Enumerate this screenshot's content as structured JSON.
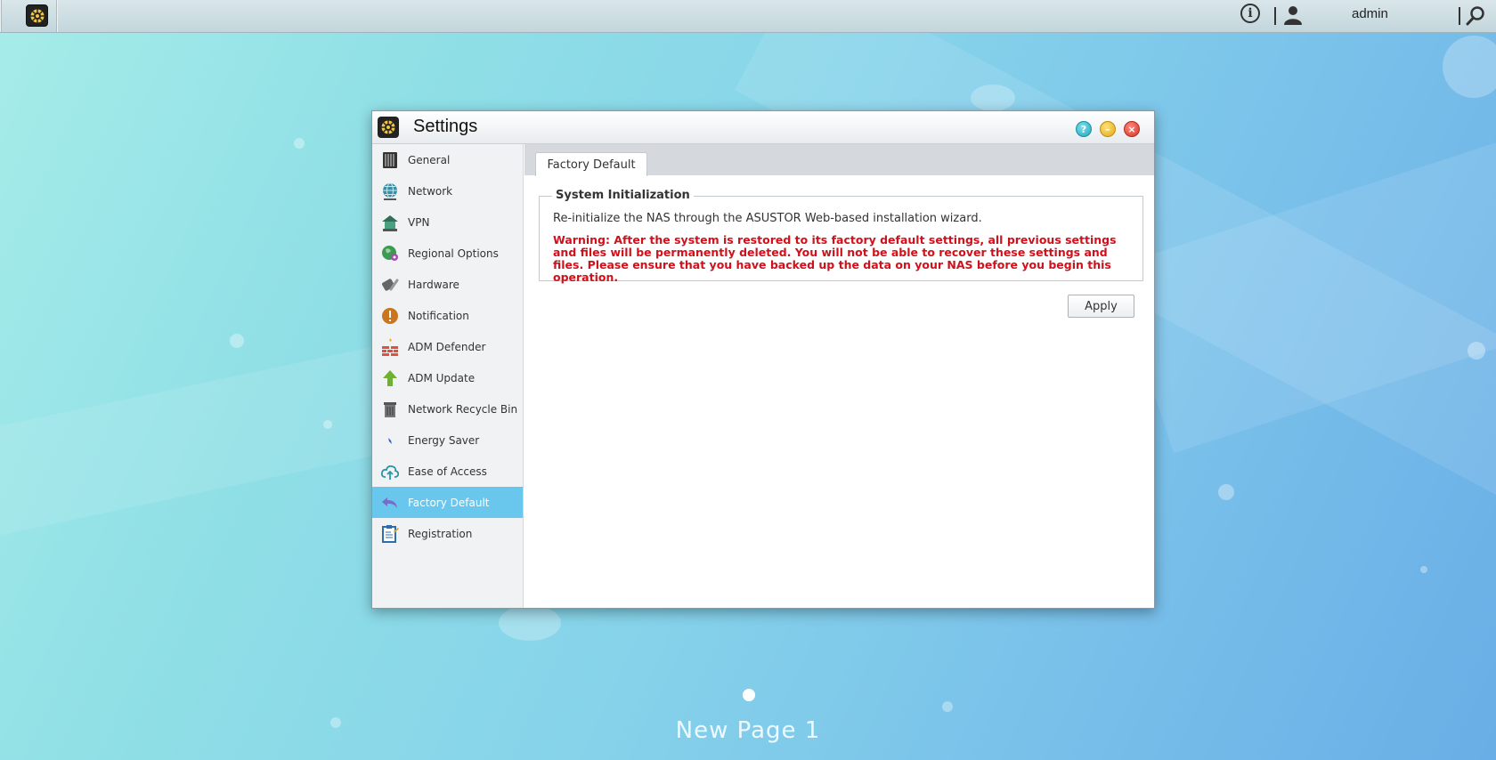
{
  "topbar": {
    "user_label": "admin"
  },
  "window": {
    "title": "Settings"
  },
  "sidebar": {
    "items": [
      {
        "label": "General",
        "icon": "server-icon"
      },
      {
        "label": "Network",
        "icon": "globe-network-icon"
      },
      {
        "label": "VPN",
        "icon": "vpn-house-icon"
      },
      {
        "label": "Regional Options",
        "icon": "globe-pin-icon"
      },
      {
        "label": "Hardware",
        "icon": "hardware-wrench-icon"
      },
      {
        "label": "Notification",
        "icon": "exclamation-icon"
      },
      {
        "label": "ADM Defender",
        "icon": "firewall-icon"
      },
      {
        "label": "ADM Update",
        "icon": "up-arrow-icon"
      },
      {
        "label": "Network Recycle Bin",
        "icon": "trash-bin-icon"
      },
      {
        "label": "Energy Saver",
        "icon": "lightning-icon"
      },
      {
        "label": "Ease of Access",
        "icon": "cloud-upload-icon"
      },
      {
        "label": "Factory Default",
        "icon": "undo-arrow-icon",
        "active": true
      },
      {
        "label": "Registration",
        "icon": "clipboard-icon"
      }
    ]
  },
  "content": {
    "tab_label": "Factory Default",
    "section_title": "System Initialization",
    "description": "Re-initialize the NAS through the ASUSTOR Web-based installation wizard.",
    "warning": "Warning: After the system is restored to its factory default settings, all previous settings and files will be permanently deleted. You will not be able to recover these settings and files. Please ensure that you have backed up the data on your NAS before you begin this operation.",
    "apply_label": "Apply"
  },
  "desktop": {
    "page_label": "New Page 1"
  },
  "colors": {
    "active_item": "#69c6ed",
    "warning_text": "#d0111b"
  }
}
